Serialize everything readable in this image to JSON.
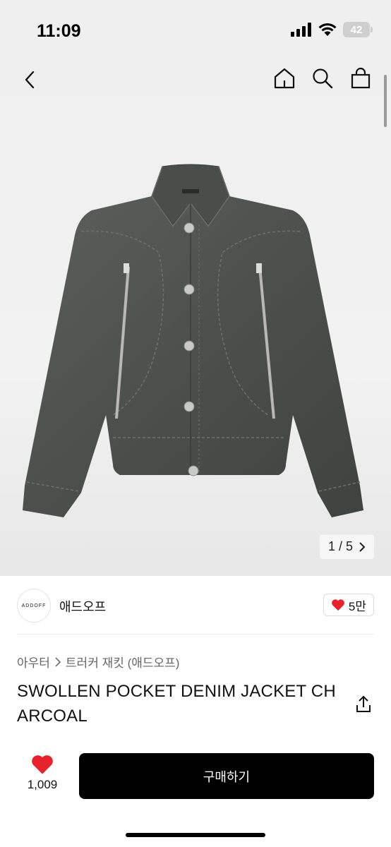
{
  "status_bar": {
    "time": "11:09",
    "battery": "42"
  },
  "icons": {
    "back": "chevron-left-icon",
    "home": "home-icon",
    "search": "search-icon",
    "bag": "shopping-bag-icon",
    "share": "share-icon",
    "heart": "heart-icon"
  },
  "gallery": {
    "pager": "1 / 5"
  },
  "brand": {
    "logo_text": "ADDOFF",
    "name": "애드오프",
    "likes": "5만"
  },
  "breadcrumb": {
    "category": "아우터",
    "subcategory": "트러커 재킷 (애드오프)"
  },
  "product": {
    "title": "SWOLLEN POCKET DENIM JACKET CHARCOAL"
  },
  "actions": {
    "favorite_count": "1,009",
    "buy_label": "구매하기"
  },
  "colors": {
    "accent_red": "#e8222b",
    "button_black": "#000000",
    "jacket": "#4f534f"
  }
}
